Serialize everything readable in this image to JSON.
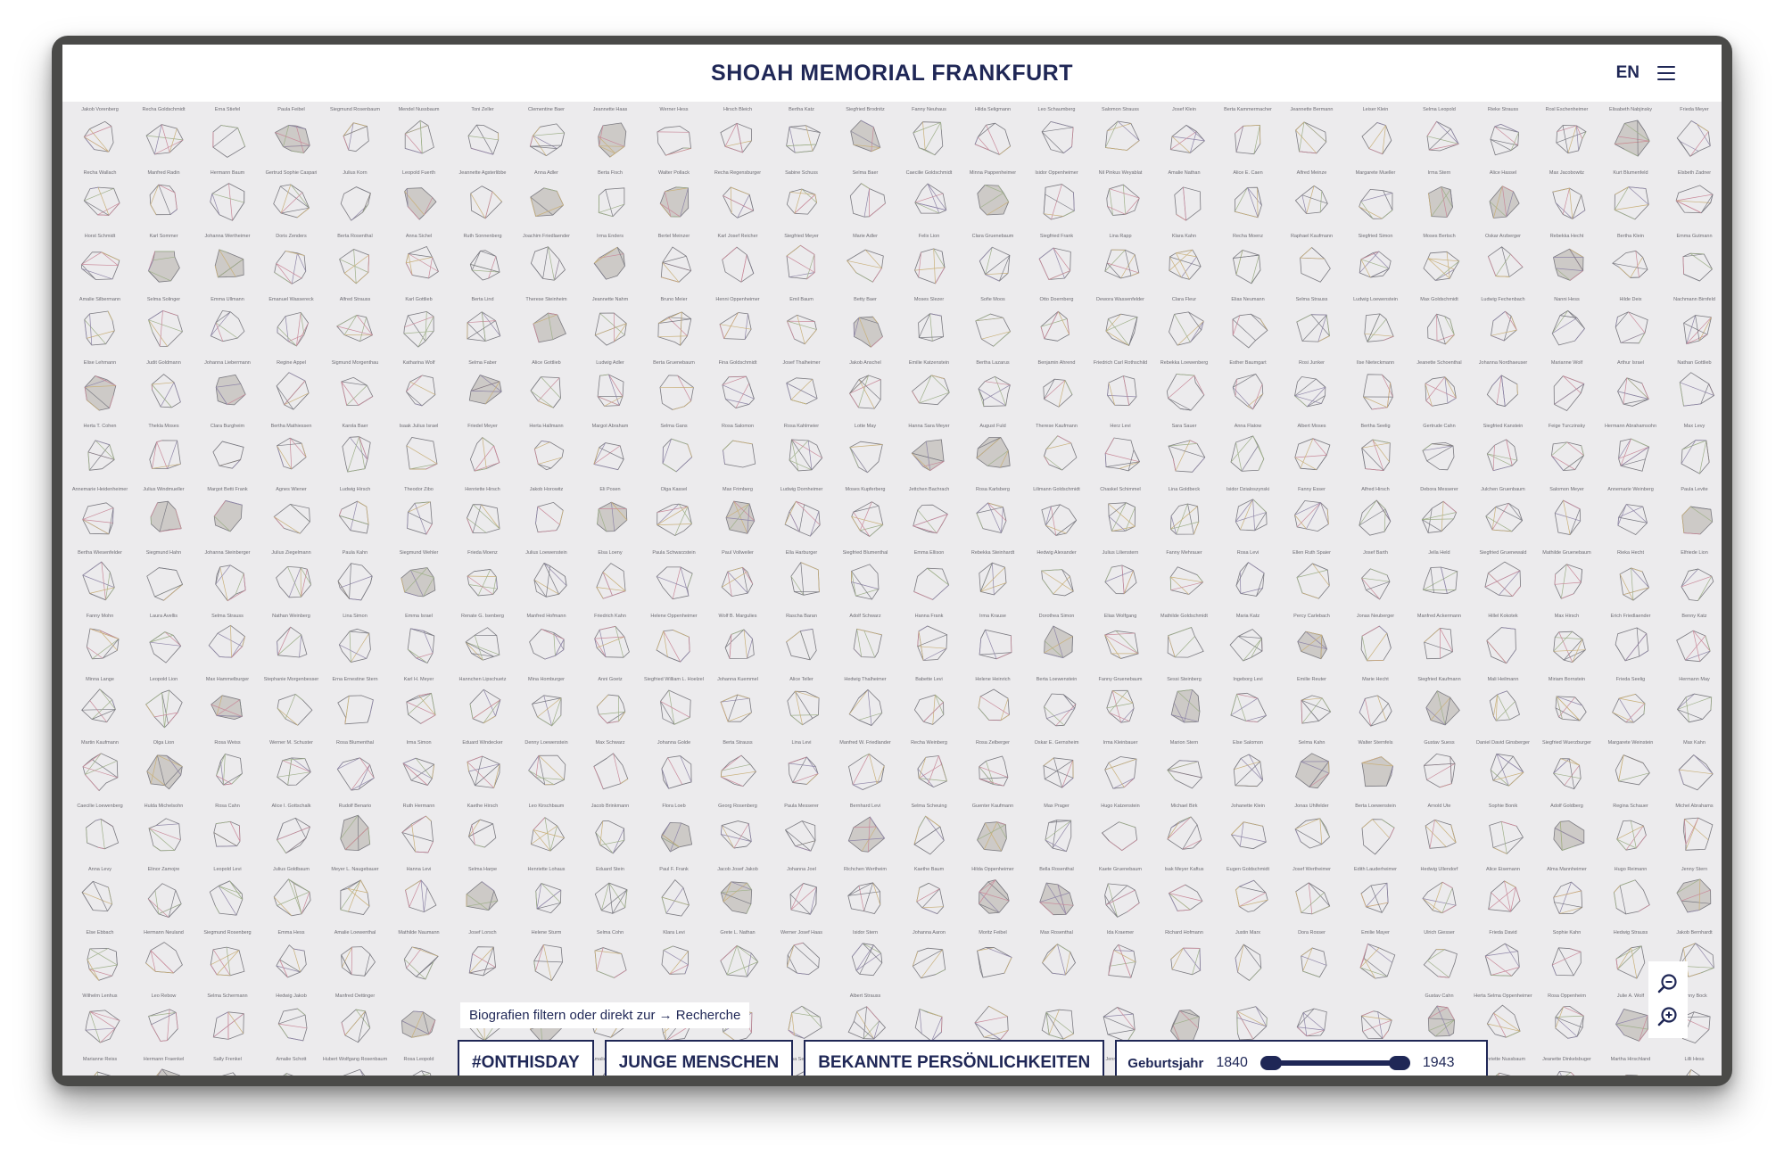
{
  "header": {
    "title": "SHOAH MEMORIAL FRANKFURT",
    "language": "EN",
    "menu_icon": "hamburger-menu-icon"
  },
  "names_rows": [
    [
      "Jakob Vorenberg",
      "Recha Goldschmidt",
      "Erna Stiefel",
      "Paula Feibel",
      "Siegmund Rosenbaum",
      "Mendel Nussbaum",
      "Toni Zeller",
      "Clementine Baer",
      "Jeannette Haas",
      "Werner Hess",
      "Hirsch Bleich",
      "Bertha Katz",
      "Siegfried Brodnitz",
      "Fanny Neuhaus",
      "Hilda Seligmann",
      "Leo Schaumberg",
      "Salomon Strauss",
      "Josef Klein",
      "Berta Kammermacher",
      "Jeannette Bermann",
      "Leiser Klein",
      "Selma Leopold",
      "Rieke Strauss",
      "Rosl Eschenheimer",
      "Elisabeth Nabjinsky",
      "Frieda Meyer"
    ],
    [
      "Recha Wallach",
      "Manfred Radin",
      "Hermann Baum",
      "Gertrud Sophie Caspari",
      "Julius Korn",
      "Leopold Fuerth",
      "Jeannette Agsterlibbe",
      "Anna Adler",
      "Berta Fisch",
      "Walter Pollack",
      "Recha Regensburger",
      "Sabine Schuss",
      "Selma Baer",
      "Caecilie Goldschmidt",
      "Minna Pappenheimer",
      "Isidor Oppenheimer",
      "Nil Pinkus Weyablat",
      "Amalie Nathan",
      "Alice E. Caen",
      "Alfred Meinze",
      "Margarete Mueller",
      "Irma Stern",
      "Alice Hassel",
      "Max Jacobowitz",
      "Kurt Blumenfeld",
      "Elsbeth Zadner"
    ],
    [
      "Horst Schmidt",
      "Karl Sommer",
      "Johanna Wertheimer",
      "Doris Zenders",
      "Berta Rosenthal",
      "Anna Sichel",
      "Ruth Sonnenberg",
      "Joachim Friedlaender",
      "Irma Enders",
      "Bertel Meinzer",
      "Karl Josef Reicher",
      "Siegfried Meyer",
      "Marie Adler",
      "Felix Lion",
      "Clara Gruenebaum",
      "Siegfried Frank",
      "Lina Rapp",
      "Klara Kahn",
      "Recha Moenz",
      "Raphael Kaufmann",
      "Siegfried Simon",
      "Moses Bertsch",
      "Oskar Arzberger",
      "Rebekka Hecht",
      "Bertha Klein",
      "Emma Gutmann"
    ],
    [
      "Amalie Silbermann",
      "Selma Solinger",
      "Emma Ullmann",
      "Emanuel Wassereck",
      "Alfred Strauss",
      "Karl Gottlieb",
      "Berta Lind",
      "Therese Steinheim",
      "Jeannette Nahm",
      "Bruno Meier",
      "Henni Oppenheimer",
      "Emil Baum",
      "Betty Baer",
      "Moses Slezer",
      "Sofie Moos",
      "Otto Doernberg",
      "Dewora Wassenfelder",
      "Clara Fleur",
      "Elias Neumann",
      "Selma Strauss",
      "Ludwig Loewenstein",
      "Max Goldschmidt",
      "Ludwig Fechenbach",
      "Nanni Hess",
      "Hilde Deix",
      "Nachmann Birnfeld"
    ],
    [
      "Elise Lehmann",
      "Judit Goldmann",
      "Johanna Liebermann",
      "Regine Appel",
      "Sigmund Morgenthau",
      "Katharina Wolf",
      "Selma Faber",
      "Alice Gottlieb",
      "Ludwig Adler",
      "Berta Gruenebaum",
      "Fina Goldschmidt",
      "Josef Thalheimer",
      "Jakob Anschel",
      "Emilie Katzenstein",
      "Bertha Lazarus",
      "Benjamin Ahrend",
      "Friedrich Carl Rothschild",
      "Rebekka Loewenberg",
      "Esther Baumgart",
      "Rosi Junker",
      "Ilse Nieteckmann",
      "Jeanette Schoenthal",
      "Johanna Nordhaeuser",
      "Marianne Wolf",
      "Arthur Israel",
      "Nathan Gottlieb"
    ],
    [
      "Herta T. Cohen",
      "Thekla Moses",
      "Clara Burgheim",
      "Bertha Mathiessen",
      "Karola Baer",
      "Isaak Julius Israel",
      "Friedel Meyer",
      "Herta Hallmann",
      "Margot Abraham",
      "Selma Gans",
      "Rosa Salomon",
      "Rosa Kahlmeier",
      "Lotte May",
      "Hanna Sara Meyer",
      "August Fuld",
      "Therese Kaufmann",
      "Herz Levi",
      "Sara Sauer",
      "Anna Flatow",
      "Albert Moses",
      "Bertha Seelig",
      "Gertrude Cahn",
      "Siegfried Kanstein",
      "Feige Turczinsky",
      "Hermann Abrahamsohn",
      "Max Levy"
    ],
    [
      "Annemarie Heidenheimer",
      "Julius Windmueller",
      "Margot Betti Frank",
      "Agnes Wiener",
      "Ludwig Hirsch",
      "Theodor Zibo",
      "Henriette Hirsch",
      "Jakob Horowitz",
      "Eli Posen",
      "Olga Kassel",
      "Max Frimberg",
      "Ludwig Dornheimer",
      "Moses Kupferberg",
      "Jettchen Bachrach",
      "Rosa Karlsberg",
      "Lilimann Goldschmidt",
      "Chaskel Schimmel",
      "Lina Goldbeck",
      "Isidor Dzialoszynski",
      "Fanny Esser",
      "Alfred Hirsch",
      "Debora Messerer",
      "Julchen Gruenbaum",
      "Salomon Meyer",
      "Annemarie Weinberg",
      "Paula Levite"
    ],
    [
      "Bertha Wiesenfelder",
      "Siegmund Hahn",
      "Johanna Steinberger",
      "Julius Ziegelmann",
      "Paula Kahn",
      "Siegmund Wehler",
      "Frieda Moenz",
      "Julius Loewenstein",
      "Elsa Loeny",
      "Paula Schwarzstein",
      "Paul Vollweiler",
      "Ella Harburger",
      "Siegfried Blumenthal",
      "Emma Ellison",
      "Rebekka Steinhardt",
      "Hedwig Alexander",
      "Julius Lilienstern",
      "Fanny Mehrauer",
      "Rosa Levi",
      "Ellen Ruth Spaier",
      "Josef Barth",
      "Jella Held",
      "Siegfried Gruenewald",
      "Mathilde Gruenebaum",
      "Rieka Hecht",
      "Elfriede Lion"
    ],
    [
      "Fanny Mohn",
      "Laura Avellis",
      "Selma Strauss",
      "Nathan Weinberg",
      "Lina Simon",
      "Emma Israel",
      "Renate G. Isenberg",
      "Manfred Hofmann",
      "Friedrich Kahn",
      "Helene Oppenheimer",
      "Wolf B. Margulies",
      "Rascha Baran",
      "Adolf Schwarz",
      "Hanna Frank",
      "Irma Krause",
      "Dorothea Simon",
      "Elias Wolfgang",
      "Mathilde Goldschmidt",
      "Maria Katz",
      "Percy Carlebach",
      "Jonas Neuberger",
      "Manfred Ackermann",
      "Hillel Kokotek",
      "Max Hirsch",
      "Erich Friedlaender",
      "Benny Katz"
    ],
    [
      "Minna Lange",
      "Leopold Lion",
      "Max Hammelburger",
      "Stephanie Morgenbesser",
      "Erna Ernestine Stern",
      "Karl H. Meyer",
      "Hannchen Lipschuetz",
      "Mina Homburger",
      "Anni Goetz",
      "Siegfried William L. Hoelzel",
      "Johanna Kuemmel",
      "Alice Teller",
      "Hedwig Thalheimer",
      "Babette Levi",
      "Helene Heinrich",
      "Berta Loewenstein",
      "Fanny Gruenebaum",
      "Sessi Steinberg",
      "Ingeborg Levi",
      "Emilie Reuter",
      "Marie Hecht",
      "Siegfried Kaufmann",
      "Mali Heilmann",
      "Miriam Bornstein",
      "Frieda Seelig",
      "Hermann May"
    ],
    [
      "Martin Kaufmann",
      "Olga Lion",
      "Rosa Weiss",
      "Werner M. Schuster",
      "Rosa Blumenthal",
      "Irma Simon",
      "Eduard Windecker",
      "Denny Loewenstein",
      "Max Schwarz",
      "Johanna Golde",
      "Berta Strauss",
      "Lina Levi",
      "Manfred W. Friedlander",
      "Recha Weinberg",
      "Rosa Zelberger",
      "Oskar E. Gernsheim",
      "Irma Kleinbauer",
      "Marion Stern",
      "Else Salomon",
      "Selma Kahn",
      "Walter Sternfels",
      "Gustav Suess",
      "Daniel David Ginsberger",
      "Siegfried Wuerzburger",
      "Margarete Weinstein",
      "Max Kahn"
    ],
    [
      "Caecilie Loewenberg",
      "Hulda Michelsohn",
      "Rosa Cahn",
      "Alice I. Gottschalk",
      "Rudolf Benario",
      "Ruth Hermann",
      "Kaethe Hirsch",
      "Leo Kirschbaum",
      "Jacob Brinkmann",
      "Flora Loeb",
      "Georg Rosenberg",
      "Paula Messerer",
      "Bernhard Levi",
      "Selma Scheuing",
      "Guenter Kaufmann",
      "Max Prager",
      "Hugo Katzenstein",
      "Michael Birk",
      "Johanette Klein",
      "Jonas Uhlfelder",
      "Berta Loewenstein",
      "Arnold Ute",
      "Sophie Bonik",
      "Adolf Goldberg",
      "Regina Schauer",
      "Michel Abrahams"
    ],
    [
      "Anna Levy",
      "Elinor Zamojre",
      "Leopold Levi",
      "Julius Goldbaum",
      "Meyer L. Naugebauer",
      "Hanna Levi",
      "Selma Harpe",
      "Henriette Lohaus",
      "Eduard Stein",
      "Paul F. Frank",
      "Jacob Josef Jakob",
      "Johanna Joel",
      "Richchen Wertheim",
      "Kaethe Baum",
      "Hilda Oppenheimer",
      "Bella Rosenthal",
      "Kaete Gruenebaum",
      "Isak Meyer Kaftus",
      "Eugen Goldschmidt",
      "Josef Wertheimer",
      "Edith Lauderheimer",
      "Hedwig Ullendorf",
      "Alice Eisemann",
      "Alma Mannheimer",
      "Hugo Reimann",
      "Jenny Stern"
    ],
    [
      "Else Ebbach",
      "Hermann Neuland",
      "Siegmund Rosenberg",
      "Emma Hess",
      "Amalie Loewenthal",
      "Mathilde Naumann",
      "Josef Lorsch",
      "Helene Sturm",
      "Selma Cohn",
      "Klara Levi",
      "Grete L. Nathan",
      "Werner Josef Haas",
      "Isidor Stern",
      "Johanna Aaron",
      "Moritz Feibel",
      "Max Rosenthal",
      "Ida Kraemer",
      "Richard Hofmann",
      "Justin Marx",
      "Dora Rosser",
      "Emilie Mayer",
      "Ulrich Giesser",
      "Frieda David",
      "Sophie Kahn",
      "Hedwig Strauss",
      "Jakob Bernhardt"
    ],
    [
      "Wilhelm Lenhus",
      "Leo Rebow",
      "Selma Schermann",
      "Hedwig Jakob",
      "Manfred Oettinger",
      "",
      "",
      "",
      "",
      "",
      "",
      "",
      "Albert Strauss",
      "",
      "",
      "",
      "",
      "",
      "",
      "",
      "",
      "Gustav Cahn",
      "Herta Selma Oppenheimer",
      "Rosa Oppenheim",
      "Julie A. Wolf",
      "Jenny Bock"
    ],
    [
      "Marianne Reiss",
      "Hermann Fraenkel",
      "Sally Frenkel",
      "Amalie Schott",
      "Hubert Wolfgang Rosenbaum",
      "Rosa Leopold",
      "Ludwig Hahn",
      "Kaethe Rothschild",
      "Amalie Neumann",
      "Max Wetterhahn",
      "Albert Simonsohn",
      "Minna Seckbach",
      "Brandla Reisker",
      "Isaak Sichel",
      "Hilda Levi",
      "Margarete Gruenstein",
      "Jenny Mehler",
      "Josef Eisenack",
      "Sofie Adler",
      "Maria Loewe",
      "Lina Goldschmidt",
      "Kurt Max Hess",
      "Henriette Nussbaum",
      "Jeanette Dinkelsbuger",
      "Martha Hirschland",
      "Lilli Hess"
    ]
  ],
  "filter": {
    "hint_text": "Biografien filtern oder direkt zur",
    "hint_arrow": "→",
    "hint_link": "Recherche",
    "buttons": [
      "#ONTHISDAY",
      "JUNGE MENSCHEN",
      "BEKANNTE PERSÖNLICHKEITEN"
    ],
    "year_label": "Geburtsjahr",
    "year_min": "1840",
    "year_max": "1943",
    "range_start_fraction": 0.0,
    "range_end_fraction": 1.0
  },
  "zoom": {
    "zoom_out_icon": "zoom-out-icon",
    "zoom_in_icon": "zoom-in-icon"
  },
  "colors": {
    "brand_navy": "#1f2756",
    "background": "#ecebed",
    "crystal_lines": [
      "#c98a9a",
      "#9fb08a",
      "#c9b07a",
      "#8f86a8",
      "#7a7a82"
    ]
  }
}
